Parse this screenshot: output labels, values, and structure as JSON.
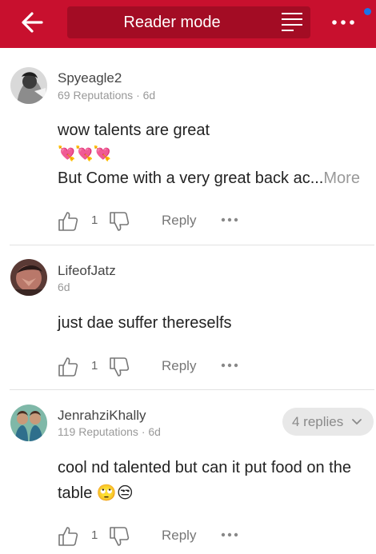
{
  "topbar": {
    "title": "Reader mode",
    "back_icon": "arrow-left-icon",
    "menu_icon": "text-lines-icon",
    "more_icon": "more-dots-icon",
    "accent_color": "#c8102e",
    "notification_dot_color": "#1a73e8"
  },
  "comments": [
    {
      "username": "Spyeagle2",
      "meta": "69 Reputations · 6d",
      "text_line1": "wow talents are great",
      "emojis": "💘💘💘",
      "text_line2": "But Come with a very great back ac...",
      "more_label": "More",
      "likes": "1",
      "reply_label": "Reply"
    },
    {
      "username": "LifeofJatz",
      "meta": "6d",
      "text_line1": "just dae suffer thereselfs",
      "likes": "1",
      "reply_label": "Reply"
    },
    {
      "username": "JenrahziKhally",
      "meta": "119 Reputations · 6d",
      "replies_label": "4 replies",
      "text_line1": "cool nd talented but can it put food on the",
      "text_line2": "table 🙄😒",
      "likes": "1",
      "reply_label": "Reply"
    }
  ]
}
